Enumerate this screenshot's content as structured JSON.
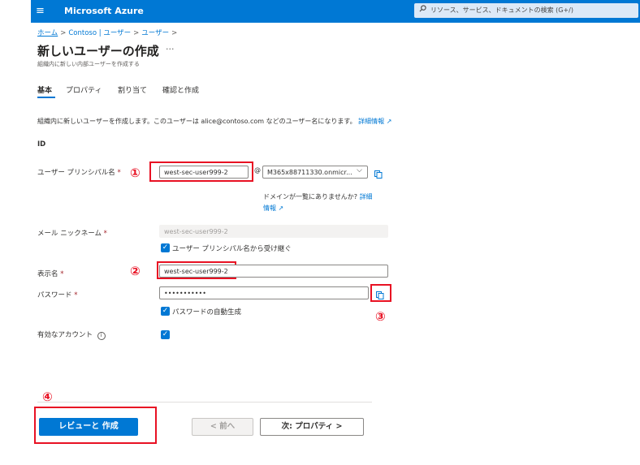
{
  "topbar": {
    "menu_icon": "≡",
    "brand": "Microsoft Azure",
    "search_placeholder": "リソース、サービス、ドキュメントの検索 (G+/)",
    "search_icon": "⚲"
  },
  "breadcrumb": {
    "home": "ホーム",
    "tenant": "Contoso | ユーザー",
    "users": "ユーザー",
    "sep": ">"
  },
  "page": {
    "title": "新しいユーザーの作成",
    "more": "···",
    "subtitle": "組織内に新しい内部ユーザーを作成する"
  },
  "tabs": [
    "基本",
    "プロパティ",
    "割り当て",
    "確認と作成"
  ],
  "intro": {
    "text": "組織内に新しいユーザーを作成します。このユーザーは alice@contoso.com などのユーザー名になります。",
    "link": "詳細情報",
    "link_icon": "↗"
  },
  "section": {
    "identity": "ID"
  },
  "form": {
    "upn": {
      "label": "ユーザー プリンシパル名",
      "required": "*",
      "value": "west-sec-user999-2",
      "at": "@",
      "domain": "M365x88711330.onmicr...",
      "domain_chevron": "⌵"
    },
    "domain_hint": {
      "text": "ドメインが一覧にありませんか?",
      "link1": "詳細",
      "link2": "情報",
      "link_icon": "↗"
    },
    "mail_nickname": {
      "label": "メール ニックネーム",
      "required": "*",
      "value": "west-sec-user999-2",
      "inherit_label": "ユーザー プリンシパル名から受け継ぐ",
      "inherit_checked": true
    },
    "display_name": {
      "label": "表示名",
      "required": "*",
      "value": "west-sec-user999-2"
    },
    "password": {
      "label": "パスワード",
      "required": "*",
      "value": "•••••••••••",
      "auto_label": "パスワードの自動生成",
      "auto_checked": true
    },
    "account_enabled": {
      "label": "有効なアカウント",
      "info_icon": "i",
      "checked": true
    }
  },
  "annotations": [
    "①",
    "②",
    "③",
    "④"
  ],
  "footer": {
    "review_create": "レビューと 作成",
    "prev": "< 前へ",
    "next": "次: プロパティ >"
  },
  "colors": {
    "accent": "#0078d4",
    "annotation": "#e81123",
    "required": "#a4262c"
  }
}
